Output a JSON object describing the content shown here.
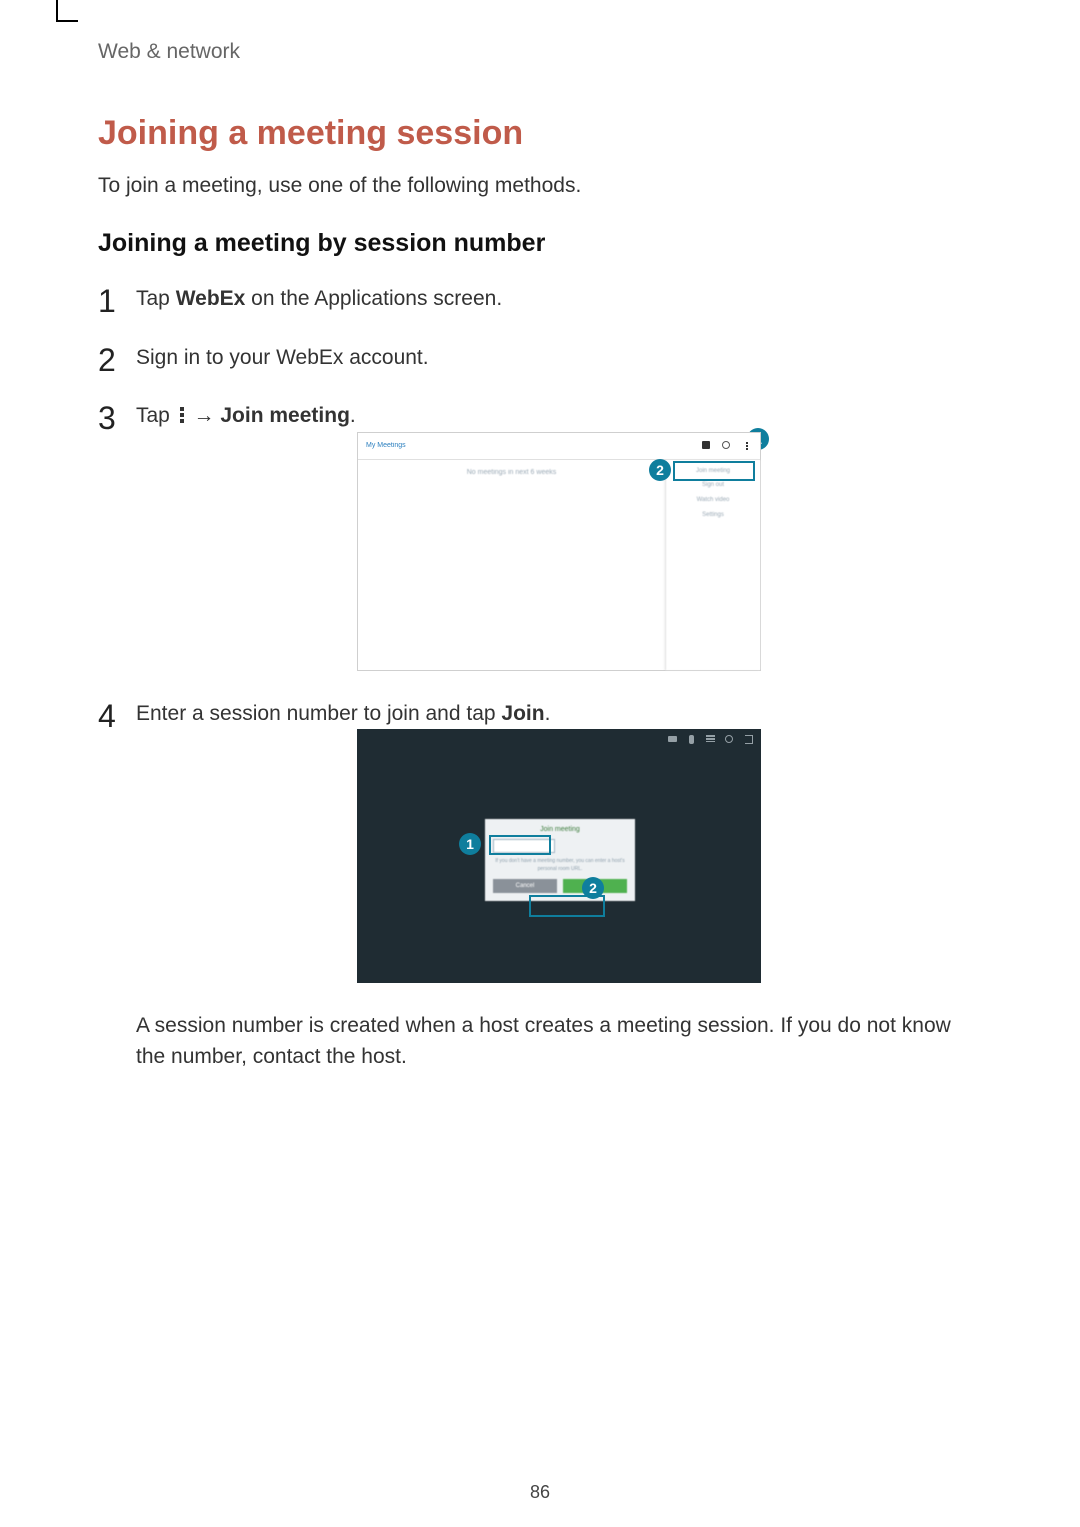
{
  "breadcrumb": "Web & network",
  "heading": "Joining a meeting session",
  "intro": "To join a meeting, use one of the following methods.",
  "subheading": "Joining a meeting by session number",
  "steps": {
    "s1_pre": "Tap ",
    "s1_bold": "WebEx",
    "s1_post": " on the Applications screen.",
    "s2": "Sign in to your WebEx account.",
    "s3_pre": "Tap ",
    "s3_arrow": " → ",
    "s3_bold": "Join meeting",
    "s3_post": ".",
    "s4_pre": "Enter a session number to join and tap ",
    "s4_bold": "Join",
    "s4_post": "."
  },
  "fig1": {
    "title": "My Meetings",
    "empty": "No meetings in next 6 weeks",
    "menu": {
      "m1": "Join meeting",
      "m2": "Sign out",
      "m3": "Watch video",
      "m4": "Settings"
    },
    "callout1": "1",
    "callout2": "2"
  },
  "fig2": {
    "popup_title": "Join meeting",
    "lines": "If you don't have a meeting number, you can enter a host's personal room URL.",
    "btn_cancel": "Cancel",
    "btn_join": "Join",
    "callout1": "1",
    "callout2": "2"
  },
  "note": "A session number is created when a host creates a meeting session. If you do not know the number, contact the host.",
  "page_number": "86"
}
